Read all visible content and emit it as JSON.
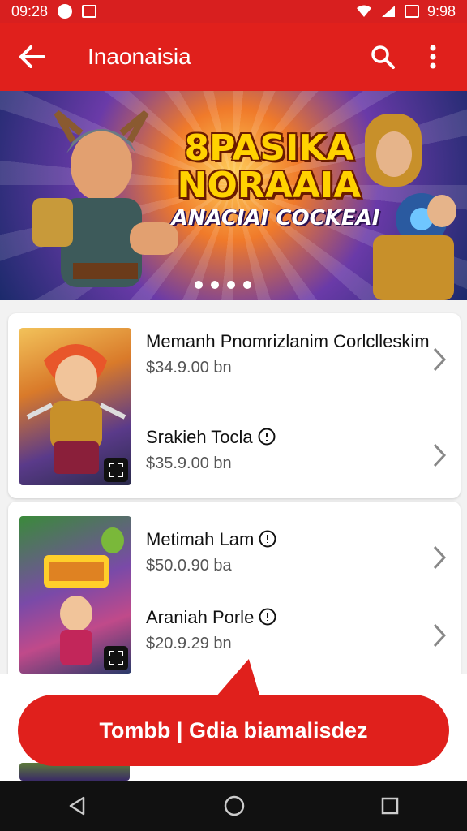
{
  "status_bar": {
    "time": "09:28",
    "right_time": "9:98"
  },
  "app_bar": {
    "title": "Inaonaisia"
  },
  "banner": {
    "headline": "8PASIKA NORAAIA",
    "subline": "ANACIAI COCKEAI",
    "pages": 4,
    "active_page": 1
  },
  "cards": [
    {
      "items": [
        {
          "name": "Memanh Pnomrizlanim Corlclleskim",
          "price": "$34.9.00  bn"
        },
        {
          "name": "Srakieh Tocla",
          "price": "$35.9.00  bn"
        }
      ]
    },
    {
      "items": [
        {
          "name": "Metimah Lam",
          "price": "$50.0.90  ba"
        },
        {
          "name": "Araniah Porle",
          "price": "$20.9.29  bn"
        }
      ]
    }
  ],
  "cta": {
    "label": "Tombb | Gdia biamalisdez"
  },
  "colors": {
    "primary": "#e0201c",
    "status": "#d81f1f"
  },
  "icons": [
    "back-arrow-icon",
    "search-icon",
    "more-vert-icon",
    "chevron-right-icon",
    "expand-icon",
    "nav-back-icon",
    "nav-home-icon",
    "nav-recents-icon"
  ]
}
